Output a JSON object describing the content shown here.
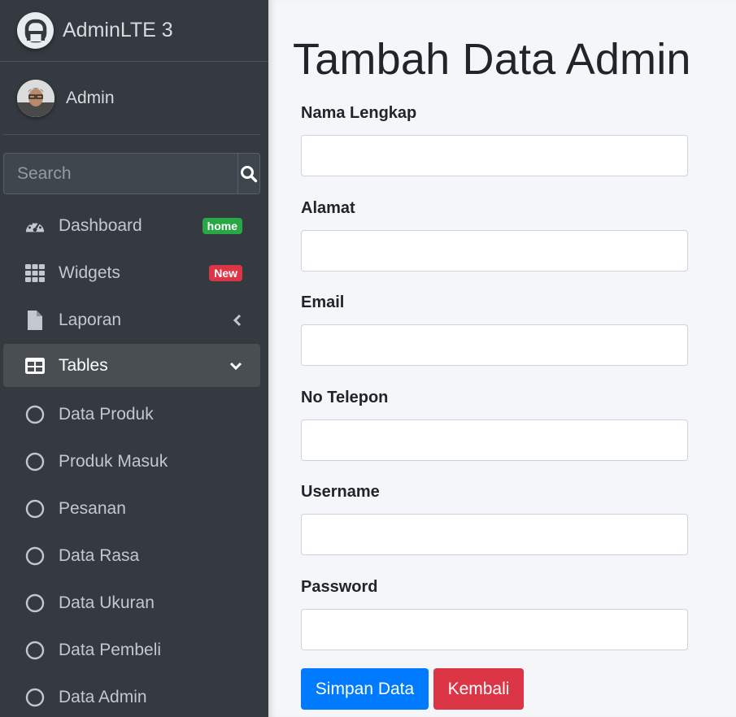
{
  "brand": {
    "name": "AdminLTE 3",
    "icon": "adminlte-logo-icon"
  },
  "user": {
    "name": "Admin",
    "avatar": "user-avatar"
  },
  "search": {
    "placeholder": "Search",
    "icon": "search-icon"
  },
  "nav": [
    {
      "label": "Dashboard",
      "icon": "tachometer-icon",
      "badge": "home",
      "badge_color": "#28a745"
    },
    {
      "label": "Widgets",
      "icon": "th-grid-icon",
      "badge": "New",
      "badge_color": "#dc3545"
    },
    {
      "label": "Laporan",
      "icon": "file-icon",
      "chevron": "chevron-left-icon"
    },
    {
      "label": "Tables",
      "icon": "table-icon",
      "chevron": "chevron-down-icon",
      "active": true
    },
    {
      "label": "Data Produk",
      "icon": "circle-icon"
    },
    {
      "label": "Produk Masuk",
      "icon": "circle-icon"
    },
    {
      "label": "Pesanan",
      "icon": "circle-icon"
    },
    {
      "label": "Data Rasa",
      "icon": "circle-icon"
    },
    {
      "label": "Data Ukuran",
      "icon": "circle-icon"
    },
    {
      "label": "Data Pembeli",
      "icon": "circle-icon"
    },
    {
      "label": "Data Admin",
      "icon": "circle-icon"
    }
  ],
  "main": {
    "title": "Tambah Data Admin",
    "fields": [
      {
        "label": "Nama Lengkap",
        "value": ""
      },
      {
        "label": "Alamat",
        "value": ""
      },
      {
        "label": "Email",
        "value": ""
      },
      {
        "label": "No Telepon",
        "value": ""
      },
      {
        "label": "Username",
        "value": ""
      },
      {
        "label": "Password",
        "value": ""
      }
    ],
    "buttons": {
      "save": "Simpan Data",
      "back": "Kembali"
    }
  },
  "colors": {
    "sidebar_bg": "#343a40",
    "primary": "#007bff",
    "danger": "#dc3545",
    "success": "#28a745"
  }
}
